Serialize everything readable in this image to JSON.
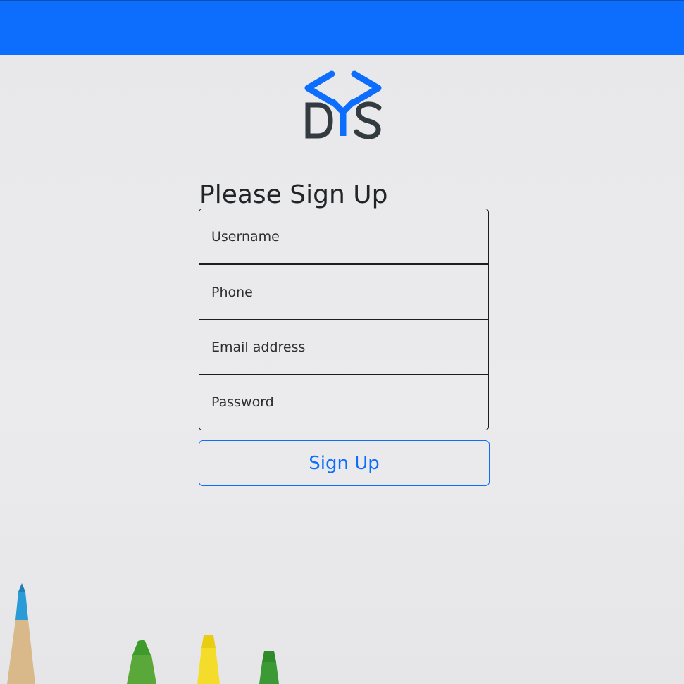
{
  "brand": {
    "logo_text": "DYS",
    "primary_color": "#0d6efd",
    "text_color": "#333a40"
  },
  "form": {
    "title": "Please Sign Up",
    "fields": {
      "username_placeholder": "Username",
      "phone_placeholder": "Phone",
      "email_placeholder": "Email address",
      "password_placeholder": "Password"
    },
    "submit_label": "Sign Up"
  },
  "background": {
    "icons": [
      "colored-pencils-decoration"
    ]
  }
}
